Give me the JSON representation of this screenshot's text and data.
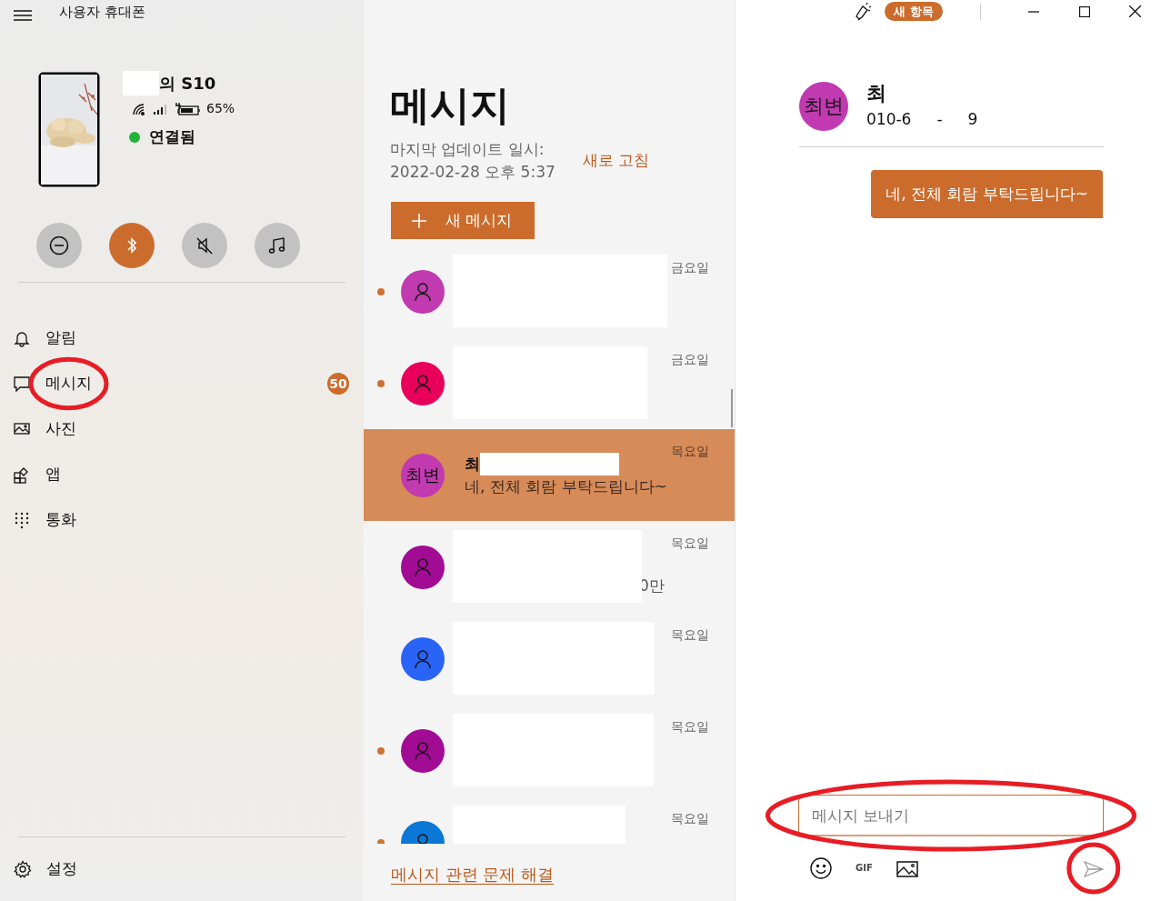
{
  "header": {
    "title": "사용자 휴대폰"
  },
  "device": {
    "name_suffix": "의 S10",
    "charging": true,
    "battery": "65%",
    "connected": true,
    "status": "연결됨"
  },
  "quick_actions": [
    {
      "kind": "dnd",
      "on": false
    },
    {
      "kind": "bluetooth",
      "on": true
    },
    {
      "kind": "mute",
      "on": false
    },
    {
      "kind": "media",
      "on": false
    }
  ],
  "sidebar": {
    "items": [
      {
        "kind": "notifications",
        "label": "알림"
      },
      {
        "kind": "messages",
        "label": "메시지",
        "badge": "50",
        "circled": true
      },
      {
        "kind": "photos",
        "label": "사진"
      },
      {
        "kind": "apps",
        "label": "앱"
      },
      {
        "kind": "calls",
        "label": "통화"
      }
    ],
    "settings": {
      "label": "설정"
    }
  },
  "messages": {
    "title": "메시지",
    "updated_label": "마지막 업데이트 일시:",
    "updated_time": "2022-02-28 오후 5:37",
    "refresh": "새로 고침",
    "new_button": "새 메시지",
    "conversations": [
      {
        "kind": "hidden",
        "unread": true,
        "selected": false,
        "color": "#c13ab0",
        "date": "금요일"
      },
      {
        "kind": "hidden",
        "unread": true,
        "selected": false,
        "color": "#e8005a",
        "date": "금요일"
      },
      {
        "kind": "named",
        "unread": false,
        "selected": true,
        "color": "#c13ab0",
        "initials": "최변",
        "name": "최",
        "snippet": "네, 전체 회람 부탁드립니다~",
        "date": "목요일"
      },
      {
        "kind": "hidden",
        "unread": false,
        "selected": false,
        "color": "#a20b94",
        "fragment": "0만",
        "date": "목요일"
      },
      {
        "kind": "hidden",
        "unread": false,
        "selected": false,
        "color": "#2a64f6",
        "date": "목요일"
      },
      {
        "kind": "hidden",
        "unread": true,
        "selected": false,
        "color": "#a20b94",
        "date": "목요일"
      },
      {
        "kind": "hidden",
        "unread": true,
        "selected": false,
        "color": "#0a78d4",
        "date": "목요일"
      }
    ],
    "help_link": "메시지 관련 문제 해결"
  },
  "titlebar": {
    "whats_new": "새 항목"
  },
  "chat": {
    "contact": {
      "initials": "최변",
      "color": "#c13ab0",
      "name": "최",
      "phone_parts": [
        "010-6",
        "-",
        "9"
      ]
    },
    "bubbles": [
      {
        "text": "네, 전체 회람 부탁드립니다~",
        "outgoing": true
      }
    ],
    "composer": {
      "placeholder": "메시지 보내기",
      "gif": "GIF",
      "field_circled": true,
      "send_circled": true
    }
  }
}
